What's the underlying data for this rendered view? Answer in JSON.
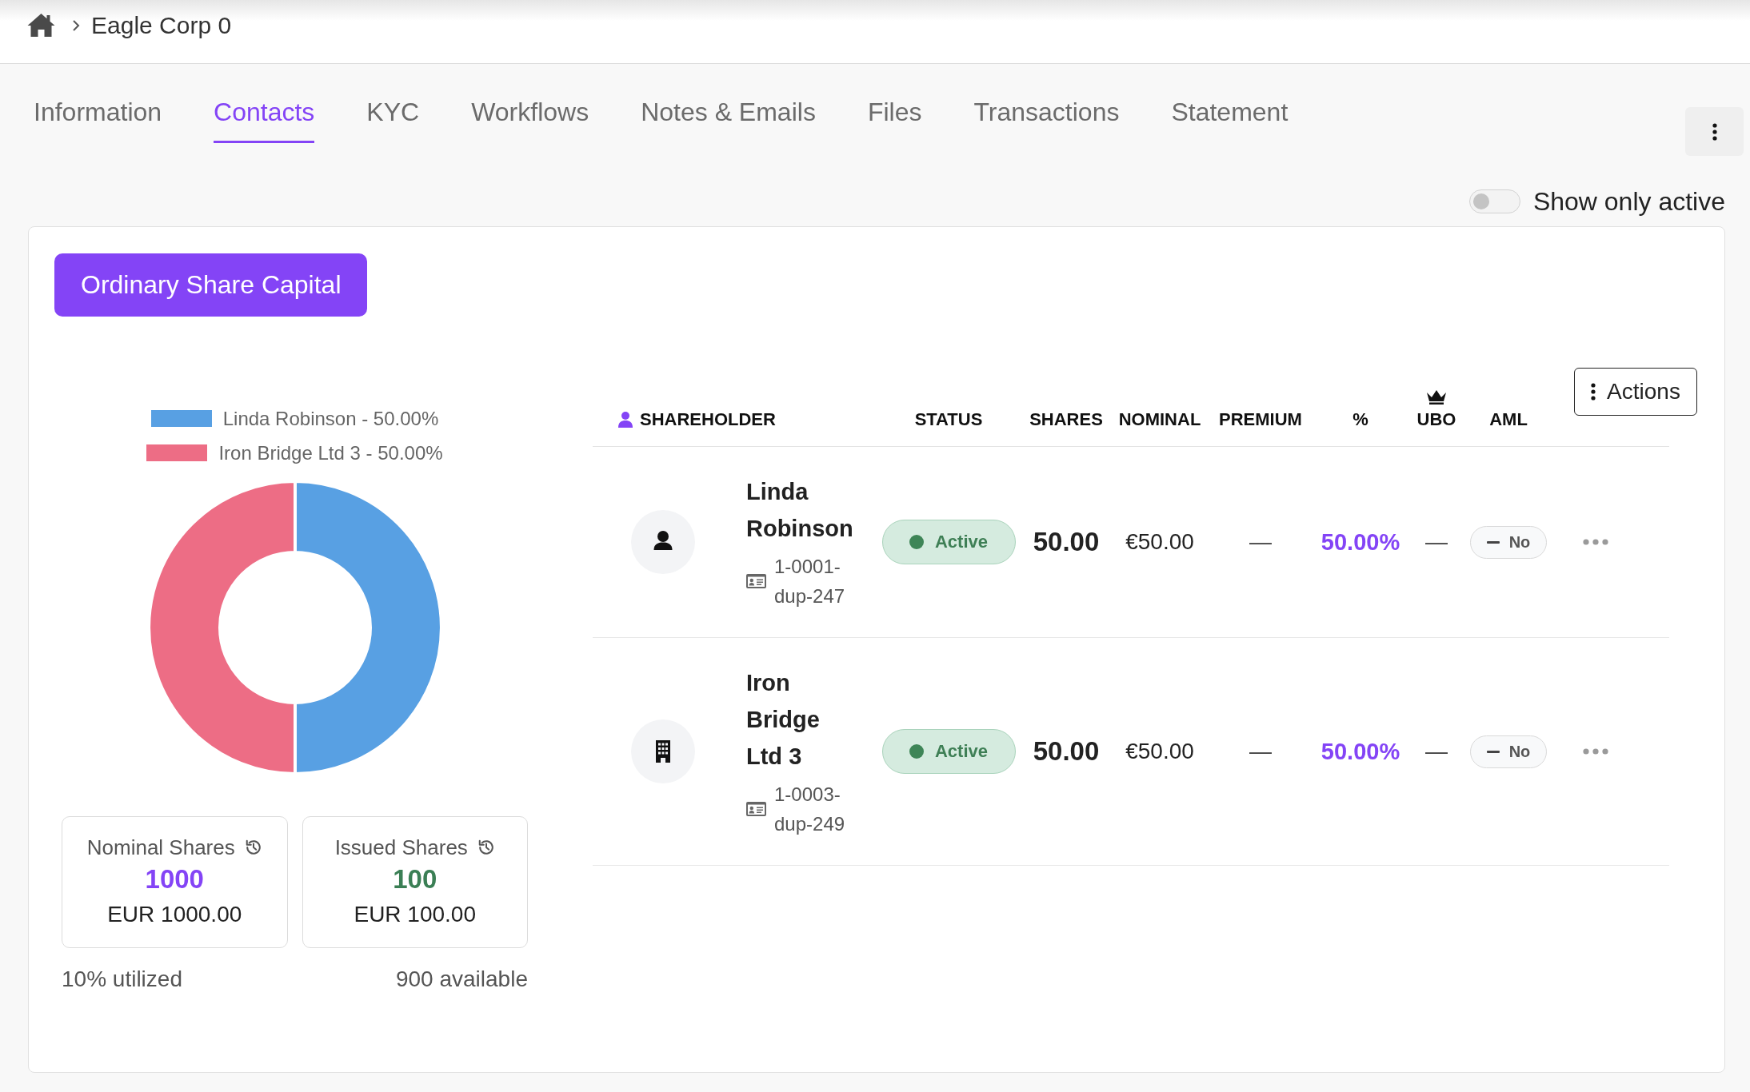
{
  "breadcrumb": {
    "current": "Eagle Corp 0"
  },
  "tabs": [
    {
      "label": "Information",
      "selected": false
    },
    {
      "label": "Contacts",
      "selected": true
    },
    {
      "label": "KYC",
      "selected": false
    },
    {
      "label": "Workflows",
      "selected": false
    },
    {
      "label": "Notes & Emails",
      "selected": false
    },
    {
      "label": "Files",
      "selected": false
    },
    {
      "label": "Transactions",
      "selected": false
    },
    {
      "label": "Statement",
      "selected": false
    }
  ],
  "filter": {
    "label": "Show only active",
    "on": false
  },
  "share_class": {
    "label": "Ordinary Share Capital"
  },
  "chart": {
    "slices": [
      {
        "color": "#58a0e3"
      },
      {
        "color": "#ed6d85"
      }
    ],
    "chart_data": {
      "type": "donut",
      "categories": [
        "Linda Robinson - 50.00%",
        "Iron Bridge Ltd 3 - 50.00%"
      ],
      "values": [
        50,
        50
      ],
      "legend": "top"
    }
  },
  "stats": [
    {
      "title": "Nominal Shares",
      "value": "1000",
      "amount": "EUR 1000.00",
      "color": "#8444f6"
    },
    {
      "title": "Issued Shares",
      "value": "100",
      "amount": "EUR 100.00",
      "color": "#3b7f55"
    }
  ],
  "utilization": {
    "utilized": "10% utilized",
    "available": "900 available"
  },
  "table": {
    "columns": [
      "SHAREHOLDER",
      "STATUS",
      "SHARES",
      "NOMINAL",
      "PREMIUM",
      "%",
      "UBO",
      "AML"
    ],
    "actions_label": "Actions",
    "rows": [
      {
        "kind": "person",
        "name": "Linda Robinson",
        "reference": "1-0001-dup-247",
        "status": "Active",
        "shares": "50.00",
        "nominal": "€50.00",
        "premium": "—",
        "percent": "50.00%",
        "ubo": "—",
        "aml": "No"
      },
      {
        "kind": "company",
        "name": "Iron Bridge Ltd 3",
        "reference": "1-0003-dup-249",
        "status": "Active",
        "shares": "50.00",
        "nominal": "€50.00",
        "premium": "—",
        "percent": "50.00%",
        "ubo": "—",
        "aml": "No"
      }
    ]
  }
}
